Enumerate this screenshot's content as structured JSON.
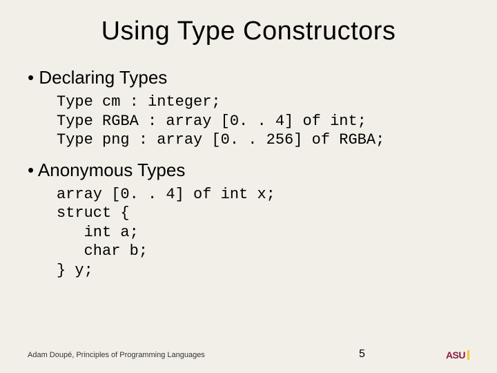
{
  "title": "Using Type Constructors",
  "sections": [
    {
      "heading": "Declaring Types",
      "code": "Type cm : integer;\nType RGBA : array [0. . 4] of int;\nType png : array [0. . 256] of RGBA;"
    },
    {
      "heading": "Anonymous Types",
      "code": "array [0. . 4] of int x;\nstruct {\n   int a;\n   char b;\n} y;"
    }
  ],
  "footer": {
    "credit": "Adam Doupé, Principles of Programming Languages",
    "page": "5",
    "logo_text": "ASU"
  }
}
